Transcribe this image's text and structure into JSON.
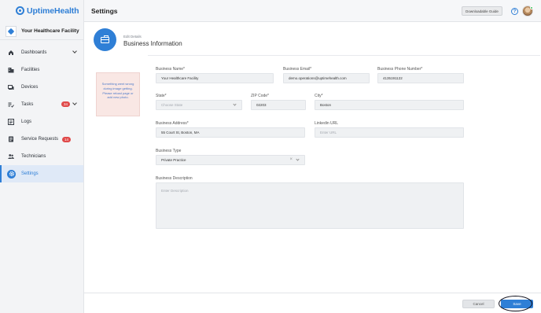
{
  "app": {
    "logo_text": "UptimeHealth"
  },
  "facility": {
    "name": "Your Healthcare Facility"
  },
  "sidebar": {
    "items": [
      {
        "label": "Dashboards",
        "icon": "home-icon",
        "has_chevron": true
      },
      {
        "label": "Facilities",
        "icon": "building-icon"
      },
      {
        "label": "Devices",
        "icon": "devices-icon"
      },
      {
        "label": "Tasks",
        "icon": "tasks-icon",
        "badge": "34",
        "has_chevron": true
      },
      {
        "label": "Logs",
        "icon": "logs-icon"
      },
      {
        "label": "Service Requests",
        "icon": "service-request-icon",
        "badge": "14"
      },
      {
        "label": "Technicians",
        "icon": "technicians-icon"
      },
      {
        "label": "Settings",
        "icon": "gear-icon",
        "active": true
      }
    ]
  },
  "header": {
    "title": "Settings",
    "guide_button": "Downloadable Guide"
  },
  "section": {
    "eyebrow": "Edit Details",
    "title": "Business Information",
    "icon": "briefcase-icon"
  },
  "image_error": "Something went wrong during image getting. Please reload page or add new photo.",
  "form": {
    "business_name": {
      "label": "Business Name*",
      "value": "Your Healthcare Facility"
    },
    "business_email": {
      "label": "Business Email*",
      "value": "demo.operations@uptimehealth.com"
    },
    "business_phone": {
      "label": "Business Phone Number*",
      "value": "4135191122"
    },
    "state": {
      "label": "State*",
      "placeholder": "Choose State"
    },
    "zip": {
      "label": "ZIP Code*",
      "value": "02203"
    },
    "city": {
      "label": "City*",
      "value": "Boston"
    },
    "address": {
      "label": "Business Address*",
      "value": "55 Court St, Boston, MA"
    },
    "linkedin": {
      "label": "Linkedin URL",
      "placeholder": "Enter URL"
    },
    "business_type": {
      "label": "Business Type",
      "value": "Private Practice"
    },
    "description": {
      "label": "Business Description",
      "placeholder": "Enter Description"
    }
  },
  "footer": {
    "cancel": "Cancel",
    "save": "Save"
  },
  "colors": {
    "accent": "#2f7fd6",
    "badge": "#e04a4a"
  }
}
